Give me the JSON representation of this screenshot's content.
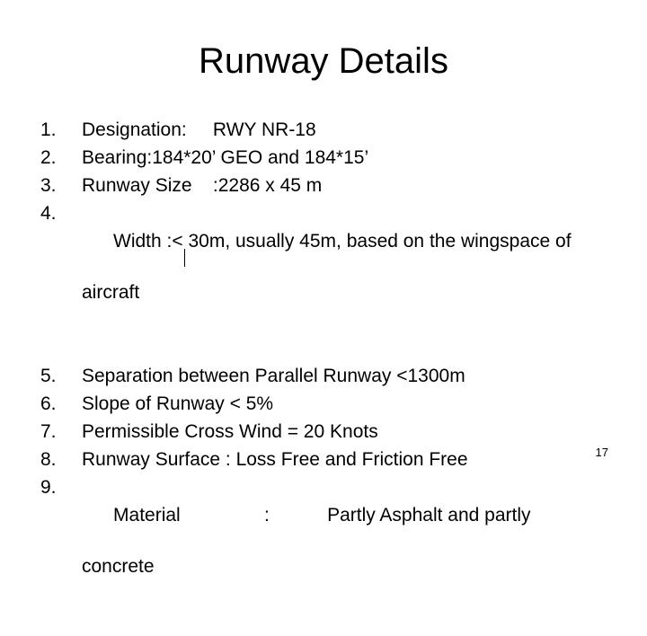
{
  "slide": {
    "title": "Runway Details",
    "items": [
      {
        "num": "1.",
        "text": "Designation:     RWY NR-18"
      },
      {
        "num": "2.",
        "text": "Bearing:184*20’ GEO and 184*15’"
      },
      {
        "num": "3.",
        "text": "Runway Size    :2286 x 45 m"
      },
      {
        "num": "4.",
        "text": "Width :< 30m, usually 45m, based on the wingspace of",
        "cont": "aircraft"
      },
      {
        "num": "5.",
        "text": "Separation between Parallel Runway <1300m"
      },
      {
        "num": "6.",
        "text": "Slope of Runway < 5%"
      },
      {
        "num": "7.",
        "text": "Permissible Cross Wind = 20 Knots"
      },
      {
        "num": "8.",
        "text": "Runway Surface : Loss Free and Friction Free"
      },
      {
        "num": "9.",
        "text": "Material                :           Partly Asphalt and partly",
        "cont": "concrete"
      }
    ],
    "page_number": "17"
  }
}
